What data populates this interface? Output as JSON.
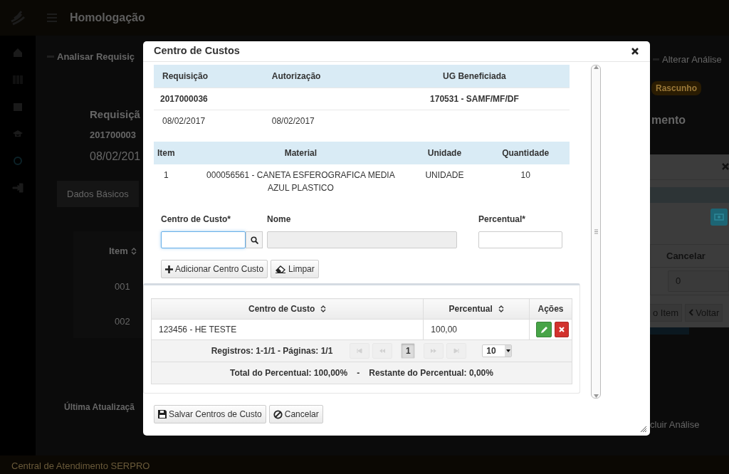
{
  "background": {
    "header": {
      "title": "Homologação"
    },
    "page_title": "Analisar Requisiç",
    "summary": {
      "label": "Requisiçã",
      "number": "201700003",
      "date": "08/02/201"
    },
    "tab": "Dados Básicos",
    "table": {
      "column": "Item",
      "rows": [
        "001",
        "002"
      ]
    },
    "last_update": "Última Atualizaçã",
    "right": {
      "action": "Alterar Análise",
      "status": "Rascunho",
      "heading": "mento",
      "conclude": "cluir Análise"
    },
    "back_dialog": {
      "column": "Cancelar",
      "value": "0",
      "buttons": [
        {
          "label": "o Item",
          "kind": "plain"
        },
        {
          "label": "Voltar",
          "kind": "back"
        }
      ]
    },
    "footer": "Central de Atendimento SERPRO"
  },
  "modal": {
    "title": "Centro de Custos",
    "request": {
      "columns": [
        "Requisição",
        "Autorização",
        "UG Beneficiada"
      ],
      "rows": [
        [
          "2017000036",
          "",
          "170531 - SAMF/MF/DF"
        ],
        [
          "08/02/2017",
          "08/02/2017",
          ""
        ]
      ]
    },
    "items": {
      "columns": [
        "Item",
        "Material",
        "Unidade",
        "Quantidade"
      ],
      "rows": [
        [
          "1",
          "000056561 - CANETA ESFEROGRAFICA MEDIA AZUL PLASTICO",
          "UNIDADE",
          "10"
        ]
      ]
    },
    "form": {
      "cost_center_label": "Centro de Custo*",
      "name_label": "Nome",
      "percent_label": "Percentual*",
      "name_disabled": true
    },
    "form_buttons": [
      {
        "label": "Adicionar Centro Custo",
        "kind": "add"
      },
      {
        "label": "Limpar",
        "kind": "clear"
      }
    ],
    "cost_table": {
      "columns": [
        {
          "label": "Centro de Custo",
          "sortable": true
        },
        {
          "label": "Percentual",
          "sortable": true
        },
        {
          "label": "Ações",
          "sortable": false
        }
      ],
      "rows": [
        {
          "cost_center": "123456 - HE TESTE",
          "percent": "100,00"
        }
      ],
      "pagination": {
        "summary": "Registros: 1-1/1 - Páginas: 1/1",
        "nav_before": [
          {
            "kind": "first",
            "disabled": true
          },
          {
            "kind": "prev",
            "disabled": true
          }
        ],
        "pages": [
          {
            "label": "1",
            "selected": true
          }
        ],
        "nav_after": [
          {
            "kind": "next",
            "disabled": true
          },
          {
            "kind": "last",
            "disabled": true
          }
        ],
        "page_size": "10"
      },
      "totals": [
        "Total do Percentual: 100,00%",
        "-",
        "Restante do Percentual: 0,00%"
      ]
    },
    "footer_buttons": [
      {
        "label": "Salvar Centros de Custo",
        "kind": "save"
      },
      {
        "label": "Cancelar",
        "kind": "cancel"
      }
    ]
  }
}
